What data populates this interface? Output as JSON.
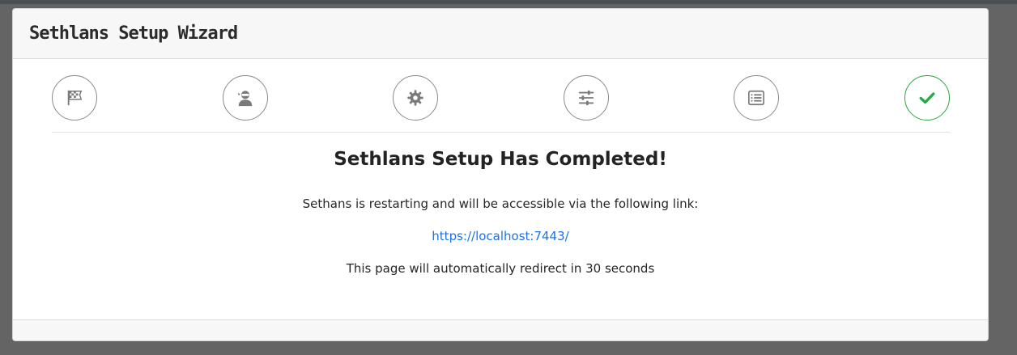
{
  "window": {
    "title": "Sethlans Setup Wizard"
  },
  "steps": [
    {
      "icon": "checkered-flag-icon",
      "state": "inactive"
    },
    {
      "icon": "user-ninja-icon",
      "state": "inactive"
    },
    {
      "icon": "gear-icon",
      "state": "inactive"
    },
    {
      "icon": "sliders-icon",
      "state": "inactive"
    },
    {
      "icon": "list-alt-icon",
      "state": "inactive"
    },
    {
      "icon": "check-icon",
      "state": "complete"
    }
  ],
  "main": {
    "heading": "Sethlans Setup Has Completed!",
    "message": "Sethans is restarting and will be accessible via the following link:",
    "link": "https://localhost:7443/",
    "redirect": "This page will automatically redirect in 30 seconds"
  },
  "colors": {
    "background": "#646464",
    "success": "#28a745",
    "link": "#1a73e8",
    "icon": "#7a7a7a"
  }
}
